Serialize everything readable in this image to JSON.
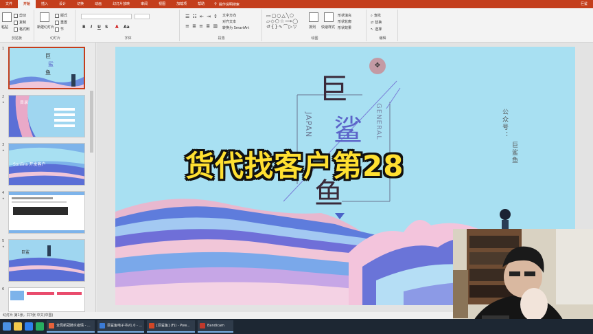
{
  "menu": {
    "tabs": [
      "文件",
      "开始",
      "插入",
      "设计",
      "切换",
      "动画",
      "幻灯片放映",
      "审阅",
      "视图",
      "加载项",
      "帮助",
      "操作说明搜索"
    ],
    "active_index": 1,
    "user": "巨鲨"
  },
  "ribbon": {
    "clipboard": {
      "paste": "粘贴",
      "cut": "剪切",
      "copy": "复制",
      "format_painter": "格式刷",
      "label": "剪贴板"
    },
    "slides": {
      "new_slide": "新建幻灯片",
      "layout": "版式",
      "reset": "重置",
      "section": "节",
      "label": "幻灯片"
    },
    "font": {
      "bold": "B",
      "italic": "I",
      "underline": "U",
      "strike": "S",
      "label": "字体"
    },
    "paragraph": {
      "label": "段落",
      "direction": "文字方向",
      "align": "对齐文本",
      "smartart": "转换为 SmartArt"
    },
    "drawing": {
      "arrange": "排列",
      "quick_styles": "快速样式",
      "fill": "形状填充",
      "outline": "形状轮廓",
      "effects": "形状效果",
      "label": "绘图"
    },
    "editing": {
      "find": "查找",
      "replace": "替换",
      "select": "选择",
      "label": "编辑"
    }
  },
  "thumbnails": [
    {
      "num": "1",
      "selected": true
    },
    {
      "num": "2",
      "selected": false
    },
    {
      "num": "3",
      "selected": false
    },
    {
      "num": "4",
      "selected": false
    },
    {
      "num": "5",
      "selected": false
    },
    {
      "num": "6",
      "selected": false
    }
  ],
  "slide": {
    "char1": "巨",
    "char2": "鲨",
    "char3": "鱼",
    "japan": "JAPAN",
    "general": "GENERAL",
    "public_account": "公众号：",
    "public_name": "巨鲨鱼",
    "move_cursor": "✥"
  },
  "overlay_caption": "货代找客户第28",
  "status": {
    "text": "幻灯片 第1张，共7张   中文(中国)"
  },
  "taskbar": {
    "tasks": [
      {
        "label": "全局新冠肺炎疫情 - ...",
        "color": "#e8623a"
      },
      {
        "label": "巨鲨鱼电子书V1.0 - ...",
        "color": "#3b7bd6"
      },
      {
        "label": "[巨鲨鱼] (F)) - Pow...",
        "color": "#d24726"
      },
      {
        "label": "Bandicam",
        "color": "#c0392b"
      }
    ]
  },
  "colors": {
    "accent": "#c43e1c",
    "slide_bg": "#a8e0f2",
    "caption": "#ffe031"
  }
}
